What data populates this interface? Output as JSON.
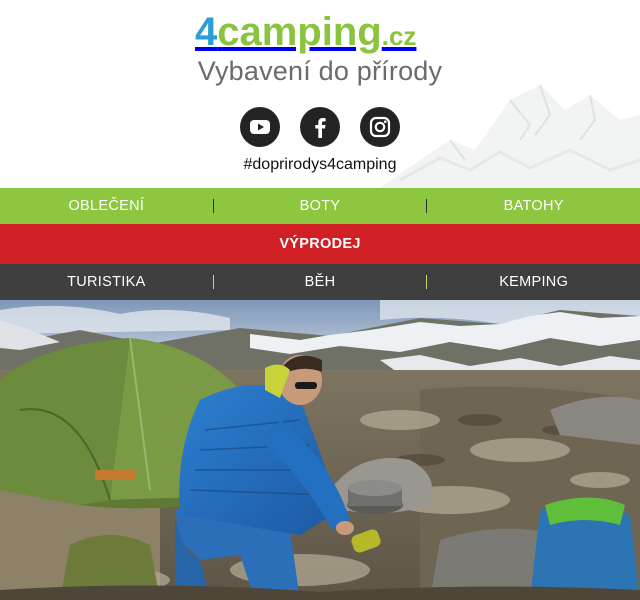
{
  "logo": {
    "part1": "4",
    "part2": "camping",
    "part3": ".cz"
  },
  "tagline": "Vybavení do přírody",
  "social": [
    {
      "icon": "youtube-icon"
    },
    {
      "icon": "facebook-icon"
    },
    {
      "icon": "instagram-icon"
    }
  ],
  "hashtag": "#doprirodys4camping",
  "nav": {
    "primary": [
      "OBLEČENÍ",
      "BOTY",
      "BATOHY"
    ],
    "sale": "VÝPRODEJ",
    "secondary": [
      "TURISTIKA",
      "BĚH",
      "KEMPING"
    ]
  },
  "colors": {
    "brand_green": "#8dc63f",
    "brand_blue": "#2a9fd6",
    "sale_red": "#d01f25",
    "dark_bar": "#3f3f3f"
  }
}
